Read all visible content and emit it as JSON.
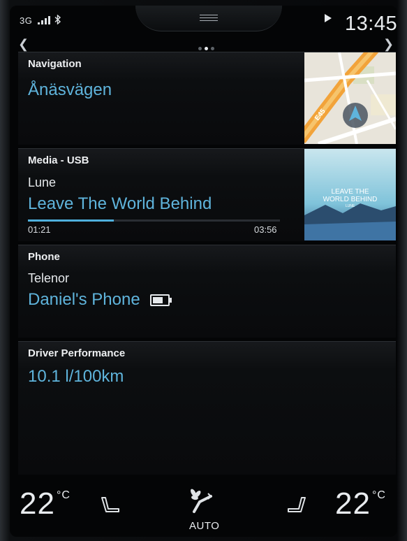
{
  "status": {
    "network": "3G",
    "bluetooth_icon": "bluetooth-icon",
    "signal_icon": "signal-bars-icon",
    "clock": "13:45"
  },
  "pager": {
    "pages": 3,
    "active": 1
  },
  "navigation": {
    "title": "Navigation",
    "destination": "Ånäsvägen",
    "map_road_label": "E45"
  },
  "media": {
    "title": "Media - USB",
    "artist": "Lune",
    "track": "Leave The World Behind",
    "elapsed": "01:21",
    "duration": "03:56",
    "progress_fraction": 0.34,
    "album_art_text": "LEAVE THE WORLD BEHIND",
    "album_art_sub": "LUNE"
  },
  "phone": {
    "title": "Phone",
    "carrier": "Telenor",
    "device": "Daniel's Phone"
  },
  "driver_performance": {
    "title": "Driver Performance",
    "value": "10.1 l/100km"
  },
  "climate": {
    "left_temp": "22",
    "right_temp": "22",
    "unit": "°C",
    "fan_mode": "AUTO"
  },
  "colors": {
    "accent": "#5fb4dc",
    "background": "#040506"
  }
}
